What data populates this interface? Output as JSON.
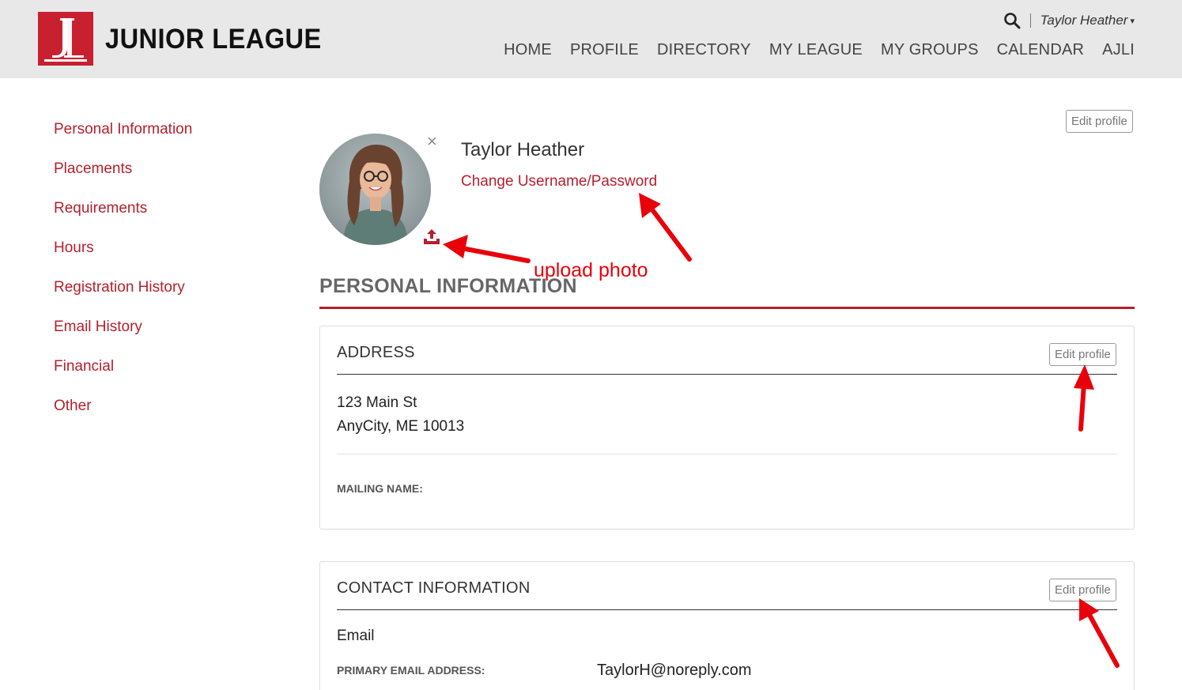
{
  "brand": {
    "logo_letters": "JL",
    "name": "JUNIOR LEAGUE",
    "accent": "#c8202f"
  },
  "utility": {
    "search_icon": "search-icon",
    "user_name": "Taylor Heather",
    "caret": "▾"
  },
  "nav": {
    "items": [
      "HOME",
      "PROFILE",
      "DIRECTORY",
      "MY LEAGUE",
      "MY GROUPS",
      "CALENDAR",
      "AJLI"
    ]
  },
  "sidebar": {
    "items": [
      "Personal Information",
      "Placements",
      "Requirements",
      "Hours",
      "Registration History",
      "Email History",
      "Financial",
      "Other"
    ]
  },
  "profile": {
    "name": "Taylor Heather",
    "change_credentials": "Change Username/Password",
    "remove_photo": "×",
    "edit_label": "Edit profile"
  },
  "annotations": {
    "upload_photo": "upload photo",
    "arrow_color": "#e8000b"
  },
  "section": {
    "title": "PERSONAL INFORMATION"
  },
  "address_card": {
    "title": "ADDRESS",
    "edit_label": "Edit profile",
    "line1": "123 Main St",
    "line2": "AnyCity, ME 10013",
    "mailing_name_label": "MAILING NAME:"
  },
  "contact_card": {
    "title": "CONTACT INFORMATION",
    "edit_label": "Edit profile",
    "email_heading": "Email",
    "primary_email_label": "PRIMARY EMAIL ADDRESS:",
    "primary_email_value": "TaylorH@noreply.com"
  }
}
